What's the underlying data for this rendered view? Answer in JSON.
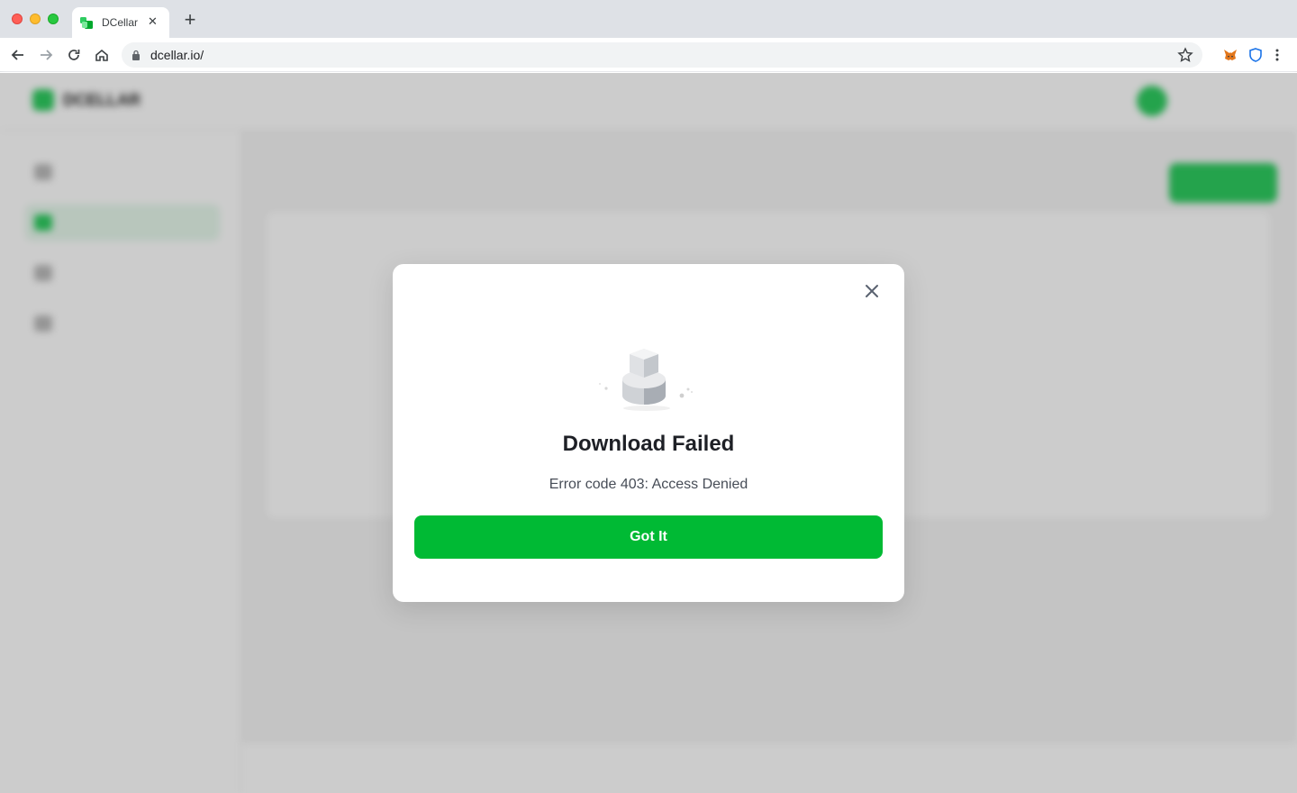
{
  "browser": {
    "tab_title": "DCellar",
    "tab_close": "✕",
    "new_tab": "+",
    "url": "dcellar.io/"
  },
  "app": {
    "logo_text": "DCELLAR",
    "account": "",
    "sidebar": {
      "items": [
        {
          "label": "",
          "active": false
        },
        {
          "label": "",
          "active": true
        },
        {
          "label": "",
          "active": false
        },
        {
          "label": "",
          "active": false
        }
      ]
    },
    "page_title": "",
    "create_button": "",
    "table_headers": [
      "",
      "",
      "",
      ""
    ],
    "footer": ""
  },
  "modal": {
    "title": "Download Failed",
    "description": "Error code 403: Access Denied",
    "button_label": "Got It"
  },
  "colors": {
    "brand_green": "#00ba34",
    "overlay": "rgba(0,0,0,0.2)"
  }
}
